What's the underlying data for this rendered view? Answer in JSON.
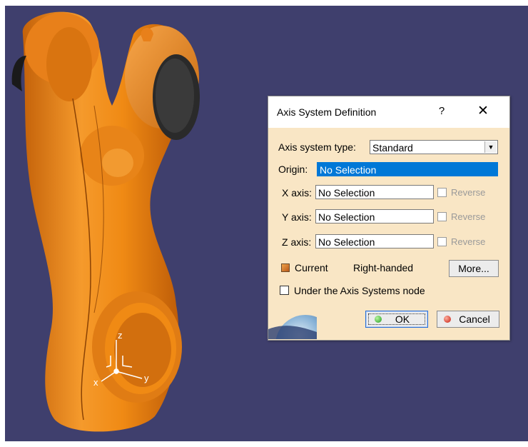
{
  "dialog": {
    "title": "Axis System Definition",
    "help_label": "?",
    "close_label": "✕",
    "type_label": "Axis system type:",
    "type_value": "Standard",
    "origin_label": "Origin:",
    "origin_value": "No Selection",
    "axes": [
      {
        "label": "X axis:",
        "value": "No Selection",
        "reverse_label": "Reverse"
      },
      {
        "label": "Y axis:",
        "value": "No Selection",
        "reverse_label": "Reverse"
      },
      {
        "label": "Z axis:",
        "value": "No Selection",
        "reverse_label": "Reverse"
      }
    ],
    "current_label": "Current",
    "handedness": "Right-handed",
    "more_label": "More...",
    "under_node_label": "Under the Axis Systems node",
    "ok_label": "OK",
    "cancel_label": "Cancel"
  },
  "viewport": {
    "background": "#3f3f6d",
    "part_color": "#f08a14",
    "axis_labels": {
      "x": "x",
      "y": "y",
      "z": "z"
    }
  }
}
